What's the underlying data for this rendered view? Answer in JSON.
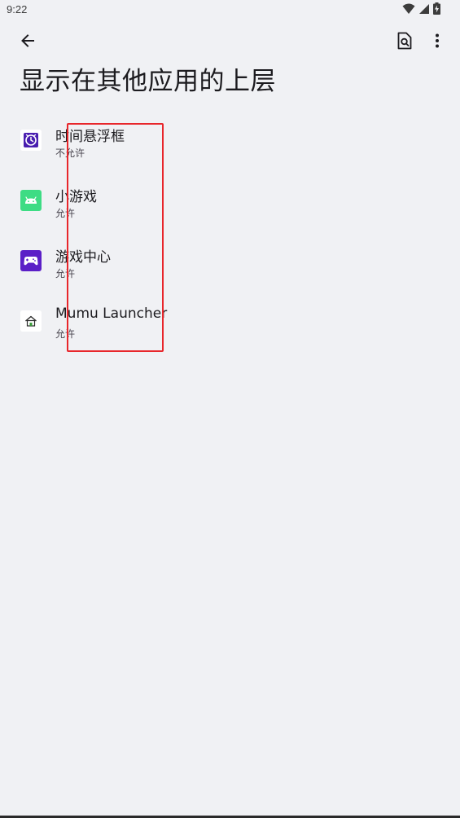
{
  "status_bar": {
    "time": "9:22",
    "icons": [
      "wifi-icon",
      "signal-icon",
      "battery-charging-icon"
    ]
  },
  "toolbar": {
    "back_icon": "arrow-left-icon",
    "search_icon": "search-page-icon",
    "more_icon": "more-vertical-icon"
  },
  "page": {
    "title": "显示在其他应用的上层"
  },
  "apps": [
    {
      "name": "时间悬浮框",
      "status": "不允许",
      "icon": "clock-app-icon"
    },
    {
      "name": "小游戏",
      "status": "允许",
      "icon": "android-app-icon"
    },
    {
      "name": "游戏中心",
      "status": "允许",
      "icon": "gamepad-app-icon"
    },
    {
      "name": "Mumu Launcher",
      "status": "允许",
      "icon": "home-launcher-icon"
    }
  ],
  "colors": {
    "background": "#f0f1f4",
    "highlight": "#e8262b",
    "android_green": "#3ddc84",
    "clock_purple": "#4a1fb0",
    "game_purple": "#5b1fc7"
  }
}
